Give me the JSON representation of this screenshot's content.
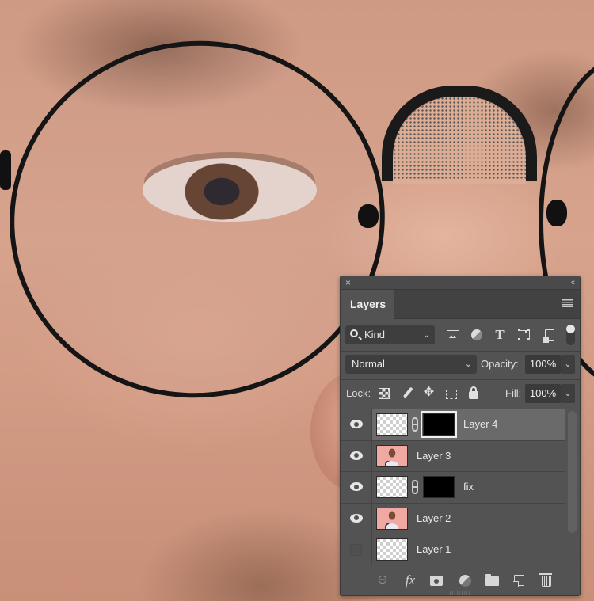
{
  "background": {
    "subject": "close-up portrait photo: eye behind round black wire-rim glasses, nose and cheek",
    "skin_tone": "#d3a08a",
    "frame_color": "#151515"
  },
  "panel": {
    "close_glyph": "×",
    "collapse_glyph": "‹‹",
    "tab_label": "Layers",
    "menu_icon": "panel-menu-icon",
    "filter": {
      "kind_label": "Kind",
      "icons": [
        "pixel-filter-icon",
        "adjustment-filter-icon",
        "type-filter-icon",
        "shape-filter-icon",
        "smart-object-filter-icon"
      ],
      "toggle_state": "on"
    },
    "blend": {
      "mode": "Normal",
      "opacity_label": "Opacity:",
      "opacity_value": "100%"
    },
    "lock": {
      "label": "Lock:",
      "icons": [
        "lock-transparent-pixels-icon",
        "lock-image-pixels-icon",
        "lock-position-icon",
        "lock-artboard-icon",
        "lock-all-icon"
      ],
      "fill_label": "Fill:",
      "fill_value": "100%",
      "move_glyph": "✥"
    },
    "layers": [
      {
        "name": "Layer 4",
        "visible": true,
        "selected": true,
        "thumbnail": "transparent",
        "has_mask": true,
        "mask_selected": true
      },
      {
        "name": "Layer 3",
        "visible": true,
        "selected": false,
        "thumbnail": "photo",
        "has_mask": false
      },
      {
        "name": "fix",
        "visible": true,
        "selected": false,
        "thumbnail": "transparent",
        "has_mask": true,
        "mask_selected": false
      },
      {
        "name": "Layer 2",
        "visible": true,
        "selected": false,
        "thumbnail": "photo",
        "has_mask": false
      },
      {
        "name": "Layer 1",
        "visible": false,
        "selected": false,
        "thumbnail": "transparent",
        "has_mask": false
      }
    ],
    "bottom_bar": {
      "link_glyph": "⊖",
      "fx_label": "fx",
      "buttons": [
        "link-layers",
        "add-layer-style",
        "add-layer-mask",
        "new-fill-adjustment-layer",
        "new-group",
        "new-layer",
        "delete-layer"
      ]
    }
  }
}
